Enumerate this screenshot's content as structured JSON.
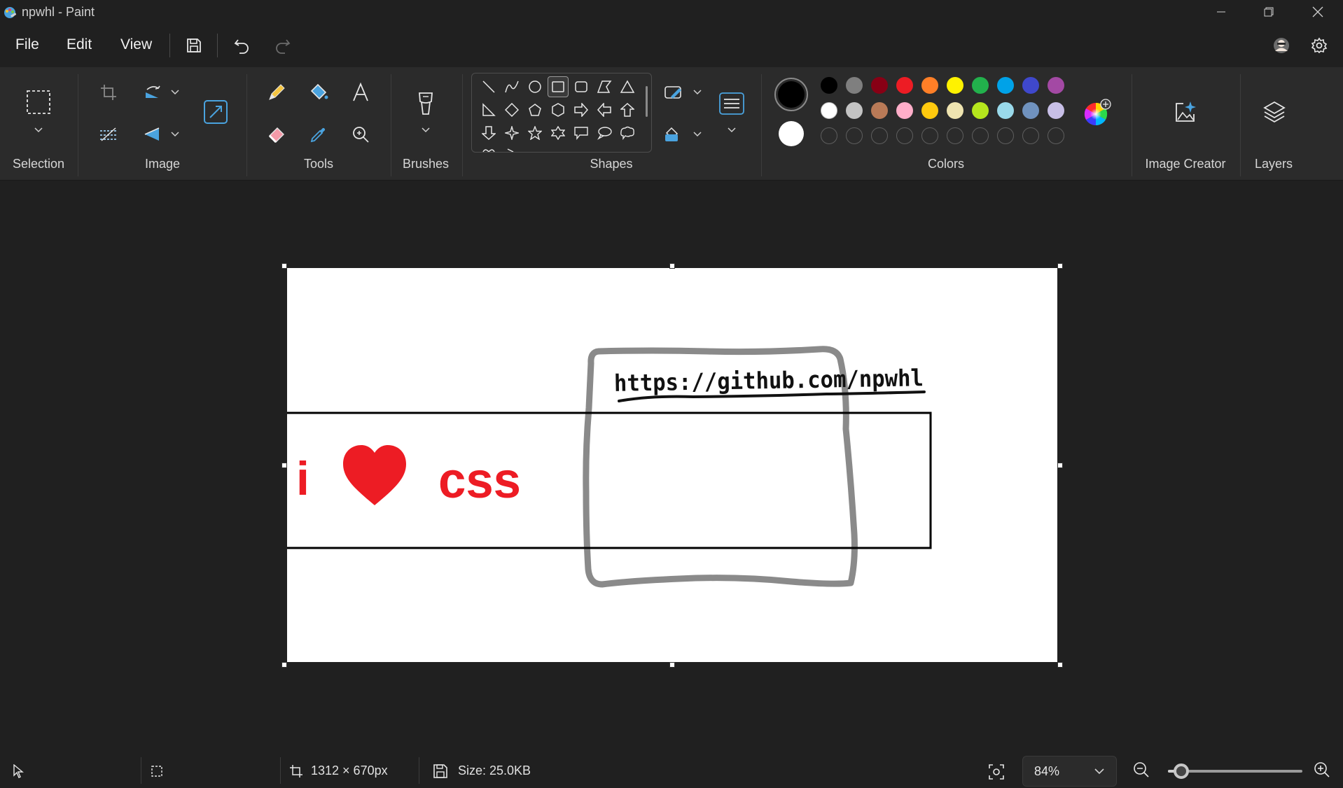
{
  "window": {
    "title": "npwhl - Paint"
  },
  "menu": {
    "file": "File",
    "edit": "Edit",
    "view": "View"
  },
  "ribbon": {
    "groups": {
      "selection": "Selection",
      "image": "Image",
      "tools": "Tools",
      "brushes": "Brushes",
      "shapes": "Shapes",
      "colors": "Colors",
      "image_creator": "Image Creator",
      "layers": "Layers"
    },
    "colors": {
      "primary": "#000000",
      "secondary": "#ffffff",
      "row1": [
        "#000000",
        "#7f7f7f",
        "#880015",
        "#ed1c24",
        "#ff7f27",
        "#fff200",
        "#22b14c",
        "#00a2e8",
        "#3f48cc",
        "#a349a4"
      ],
      "row2": [
        "#ffffff",
        "#c3c3c3",
        "#b97a57",
        "#ffaec9",
        "#ffc90e",
        "#efe4b0",
        "#b5e61d",
        "#99d9ea",
        "#7092be",
        "#c8bfe7"
      ],
      "row3_empty_count": 10
    }
  },
  "canvas": {
    "text_i": "i",
    "text_css": "css",
    "url_text": "https://github.com/npwhl",
    "accent_red": "#ed1c24",
    "gray_stroke": "#8a8a8a"
  },
  "status": {
    "dimensions": "1312 × 670px",
    "size": "Size: 25.0KB",
    "zoom": "84%",
    "zoom_fraction": 0.1
  }
}
